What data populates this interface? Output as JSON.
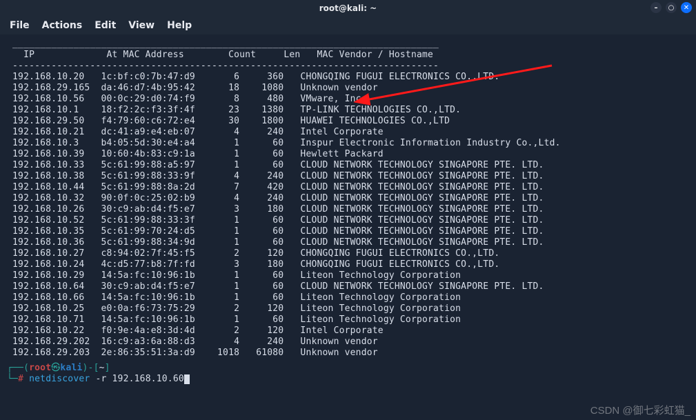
{
  "window": {
    "title": "root@kali: ~"
  },
  "menu": {
    "file": "File",
    "actions": "Actions",
    "edit": "Edit",
    "view": "View",
    "help": "Help"
  },
  "headers": {
    "ip": "IP",
    "mac": "At MAC Address",
    "count": "Count",
    "len": "Len",
    "vendor": "MAC Vendor / Hostname"
  },
  "rows": [
    {
      "ip": "192.168.10.20",
      "mac": "1c:bf:c0:7b:47:d9",
      "count": "6",
      "len": "360",
      "vendor": "CHONGQING FUGUI ELECTRONICS CO.,LTD."
    },
    {
      "ip": "192.168.29.165",
      "mac": "da:46:d7:4b:95:42",
      "count": "18",
      "len": "1080",
      "vendor": "Unknown vendor"
    },
    {
      "ip": "192.168.10.56",
      "mac": "00:0c:29:d0:74:f9",
      "count": "8",
      "len": "480",
      "vendor": "VMware, Inc."
    },
    {
      "ip": "192.168.10.1",
      "mac": "18:f2:2c:f3:3f:4f",
      "count": "23",
      "len": "1380",
      "vendor": "TP-LINK TECHNOLOGIES CO.,LTD."
    },
    {
      "ip": "192.168.29.50",
      "mac": "f4:79:60:c6:72:e4",
      "count": "30",
      "len": "1800",
      "vendor": "HUAWEI TECHNOLOGIES CO.,LTD"
    },
    {
      "ip": "192.168.10.21",
      "mac": "dc:41:a9:e4:eb:07",
      "count": "4",
      "len": "240",
      "vendor": "Intel Corporate"
    },
    {
      "ip": "192.168.10.3",
      "mac": "b4:05:5d:30:e4:a4",
      "count": "1",
      "len": "60",
      "vendor": "Inspur Electronic Information Industry Co.,Ltd."
    },
    {
      "ip": "192.168.10.39",
      "mac": "10:60:4b:83:c9:1a",
      "count": "1",
      "len": "60",
      "vendor": "Hewlett Packard"
    },
    {
      "ip": "192.168.10.33",
      "mac": "5c:61:99:88:a5:97",
      "count": "1",
      "len": "60",
      "vendor": "CLOUD NETWORK TECHNOLOGY SINGAPORE PTE. LTD."
    },
    {
      "ip": "192.168.10.38",
      "mac": "5c:61:99:88:33:9f",
      "count": "4",
      "len": "240",
      "vendor": "CLOUD NETWORK TECHNOLOGY SINGAPORE PTE. LTD."
    },
    {
      "ip": "192.168.10.44",
      "mac": "5c:61:99:88:8a:2d",
      "count": "7",
      "len": "420",
      "vendor": "CLOUD NETWORK TECHNOLOGY SINGAPORE PTE. LTD."
    },
    {
      "ip": "192.168.10.32",
      "mac": "90:0f:0c:25:02:b9",
      "count": "4",
      "len": "240",
      "vendor": "CLOUD NETWORK TECHNOLOGY SINGAPORE PTE. LTD."
    },
    {
      "ip": "192.168.10.26",
      "mac": "30:c9:ab:d4:f5:e7",
      "count": "3",
      "len": "180",
      "vendor": "CLOUD NETWORK TECHNOLOGY SINGAPORE PTE. LTD."
    },
    {
      "ip": "192.168.10.52",
      "mac": "5c:61:99:88:33:3f",
      "count": "1",
      "len": "60",
      "vendor": "CLOUD NETWORK TECHNOLOGY SINGAPORE PTE. LTD."
    },
    {
      "ip": "192.168.10.35",
      "mac": "5c:61:99:70:24:d5",
      "count": "1",
      "len": "60",
      "vendor": "CLOUD NETWORK TECHNOLOGY SINGAPORE PTE. LTD."
    },
    {
      "ip": "192.168.10.36",
      "mac": "5c:61:99:88:34:9d",
      "count": "1",
      "len": "60",
      "vendor": "CLOUD NETWORK TECHNOLOGY SINGAPORE PTE. LTD."
    },
    {
      "ip": "192.168.10.27",
      "mac": "c8:94:02:7f:45:f5",
      "count": "2",
      "len": "120",
      "vendor": "CHONGQING FUGUI ELECTRONICS CO.,LTD."
    },
    {
      "ip": "192.168.10.24",
      "mac": "4c:d5:77:b8:7f:fd",
      "count": "3",
      "len": "180",
      "vendor": "CHONGQING FUGUI ELECTRONICS CO.,LTD."
    },
    {
      "ip": "192.168.10.29",
      "mac": "14:5a:fc:10:96:1b",
      "count": "1",
      "len": "60",
      "vendor": "Liteon Technology Corporation"
    },
    {
      "ip": "192.168.10.64",
      "mac": "30:c9:ab:d4:f5:e7",
      "count": "1",
      "len": "60",
      "vendor": "CLOUD NETWORK TECHNOLOGY SINGAPORE PTE. LTD."
    },
    {
      "ip": "192.168.10.66",
      "mac": "14:5a:fc:10:96:1b",
      "count": "1",
      "len": "60",
      "vendor": "Liteon Technology Corporation"
    },
    {
      "ip": "192.168.10.25",
      "mac": "e0:0a:f6:73:75:29",
      "count": "2",
      "len": "120",
      "vendor": "Liteon Technology Corporation"
    },
    {
      "ip": "192.168.10.71",
      "mac": "14:5a:fc:10:96:1b",
      "count": "1",
      "len": "60",
      "vendor": "Liteon Technology Corporation"
    },
    {
      "ip": "192.168.10.22",
      "mac": "f0:9e:4a:e8:3d:4d",
      "count": "2",
      "len": "120",
      "vendor": "Intel Corporate"
    },
    {
      "ip": "192.168.29.202",
      "mac": "16:c9:a3:6a:88:d3",
      "count": "4",
      "len": "240",
      "vendor": "Unknown vendor"
    },
    {
      "ip": "192.168.29.203",
      "mac": "2e:86:35:51:3a:d9",
      "count": "1018",
      "len": "61080",
      "vendor": "Unknown vendor"
    }
  ],
  "prompt": {
    "user": "root",
    "at": "㉿",
    "host": "kali",
    "path": "~",
    "symbol": "#",
    "command": "netdiscover",
    "args": "-r 192.168.10.60"
  },
  "watermark": "CSDN @御七彩虹猫_"
}
